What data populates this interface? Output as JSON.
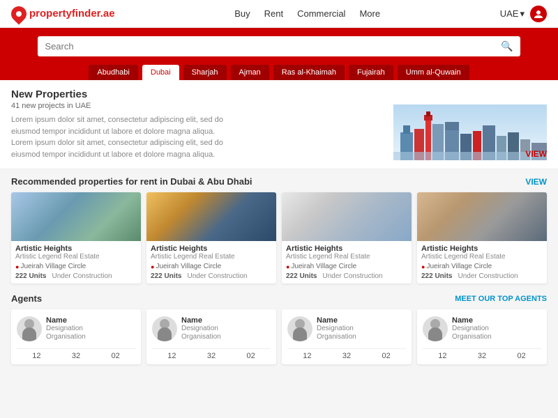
{
  "header": {
    "logo_text_main": "property",
    "logo_text_highlight": "finder",
    "logo_text_suffix": ".ae",
    "nav": {
      "buy": "Buy",
      "rent": "Rent",
      "commercial": "Commercial",
      "more": "More"
    },
    "country": "UAE",
    "search_placeholder": "Search"
  },
  "city_tabs": [
    {
      "label": "Abudhabi",
      "active": false
    },
    {
      "label": "Dubai",
      "active": false
    },
    {
      "label": "Sharjah",
      "active": false
    },
    {
      "label": "Ajman",
      "active": false
    },
    {
      "label": "Ras al-Khaimah",
      "active": false
    },
    {
      "label": "Fujairah",
      "active": false
    },
    {
      "label": "Umm al-Quwain",
      "active": false
    }
  ],
  "new_properties": {
    "title": "New Properties",
    "subtitle": "41 new projects in UAE",
    "description": "Lorem ipsum dolor sit amet, consectetur adipiscing elit, sed do eiusmod tempor incididunt ut labore et dolore magna aliqua. Lorem ipsum dolor sit amet, consectetur adipiscing elit, sed do eiusmod tempor incididunt ut labore et dolore magna aliqua.",
    "view_label": "VIEW"
  },
  "recommended": {
    "title": "Recommended properties for rent in Dubai & Abu Dhabi",
    "view_label": "VIEW",
    "properties": [
      {
        "name": "Artistic Heights",
        "org": "Artistic Legend Real Estate",
        "location": "Jueirah Village Circle",
        "units": "222 Units",
        "status": "Under Construction"
      },
      {
        "name": "Artistic Heights",
        "org": "Artistic Legend Real Estate",
        "location": "Jueirah Village Circle",
        "units": "222 Units",
        "status": "Under Construction"
      },
      {
        "name": "Artistic Heights",
        "org": "Artistic Legend Real Estate",
        "location": "Jueirah Village Circle",
        "units": "222 Units",
        "status": "Under Construction"
      },
      {
        "name": "Artistic Heights",
        "org": "Artistic Legend Real Estate",
        "location": "Jueirah Village Circle",
        "units": "222 Units",
        "status": "Under Construction"
      }
    ]
  },
  "agents": {
    "section_title": "Agents",
    "meet_label": "MEET OUR TOP AGENTS",
    "cards": [
      {
        "name": "Name",
        "designation": "Designation",
        "org": "Organisation",
        "stat1": "12",
        "stat2": "32",
        "stat3": "02"
      },
      {
        "name": "Name",
        "designation": "Designation",
        "org": "Organisation",
        "stat1": "12",
        "stat2": "32",
        "stat3": "02"
      },
      {
        "name": "Name",
        "designation": "Designation",
        "org": "Organisation",
        "stat1": "12",
        "stat2": "32",
        "stat3": "02"
      },
      {
        "name": "Name",
        "designation": "Designation",
        "org": "Organisation",
        "stat1": "12",
        "stat2": "32",
        "stat3": "02"
      }
    ]
  }
}
